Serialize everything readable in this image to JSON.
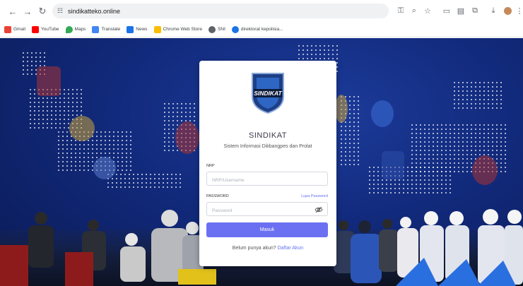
{
  "browser": {
    "url": "sindikatteko.online",
    "bookmarks": [
      {
        "label": "Gmail",
        "icon": "gmail-icon",
        "color": "#ea4335"
      },
      {
        "label": "YouTube",
        "icon": "youtube-icon",
        "color": "#ff0000"
      },
      {
        "label": "Maps",
        "icon": "maps-icon",
        "color": "#34a853"
      },
      {
        "label": "Translate",
        "icon": "translate-icon",
        "color": "#4285f4"
      },
      {
        "label": "News",
        "icon": "news-icon",
        "color": "#1a73e8"
      },
      {
        "label": "Chrome Web Store",
        "icon": "chrome-web-store-icon",
        "color": "#fbbc04"
      },
      {
        "label": "SNI",
        "icon": "globe-icon",
        "color": "#5f6368"
      },
      {
        "label": "direktorat kepolisia...",
        "icon": "site-icon",
        "color": "#1a73e8"
      }
    ]
  },
  "login": {
    "logo_text": "SINDIKAT",
    "title": "SINDIKAT",
    "subtitle": "Sistem Informasi Dikbangpes dan Prolat",
    "nrp_label": "NRP",
    "nrp_placeholder": "NRP/Username",
    "password_label": "PASSWORD",
    "forgot_label": "Lupa Password",
    "password_placeholder": "Password",
    "submit_label": "Masuk",
    "signup_text": "Belum punya akun?",
    "signup_link": "Daftar Akun"
  },
  "colors": {
    "accent": "#6b70f2",
    "background": "#122a7c"
  }
}
